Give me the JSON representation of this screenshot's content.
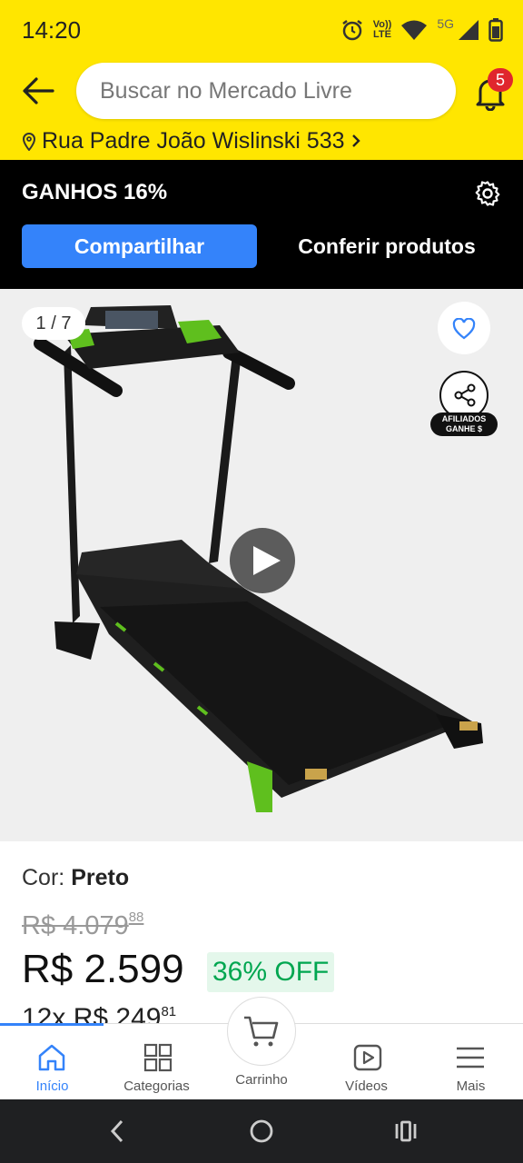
{
  "status_bar": {
    "time": "14:20",
    "volte_top": "Vo))",
    "volte_bottom": "LTE",
    "network": "5G"
  },
  "header": {
    "search_placeholder": "Buscar no Mercado Livre",
    "notification_count": "5",
    "address": "Rua Padre João Wislinski 533"
  },
  "affiliates": {
    "earnings": "GANHOS 16%",
    "share_button": "Compartilhar",
    "check_button": "Conferir produtos"
  },
  "gallery": {
    "counter": "1 / 7",
    "affiliates_badge_line1": "AFILIADOS",
    "affiliates_badge_line2": "GANHE $"
  },
  "product": {
    "color_label": "Cor:",
    "color_value": "Preto",
    "old_price": "R$ 4.079",
    "old_price_cents": "88",
    "price": "R$ 2.599",
    "discount": "36% OFF",
    "installments": "12x R$ 249",
    "installments_cents": "81"
  },
  "bottom_nav": {
    "items": [
      {
        "label": "Início"
      },
      {
        "label": "Categorias"
      },
      {
        "label": "Carrinho"
      },
      {
        "label": "Vídeos"
      },
      {
        "label": "Mais"
      }
    ]
  },
  "colors": {
    "brand_yellow": "#FFE600",
    "primary_blue": "#3483FA",
    "discount_green": "#00A650",
    "badge_red": "#E0262D"
  }
}
